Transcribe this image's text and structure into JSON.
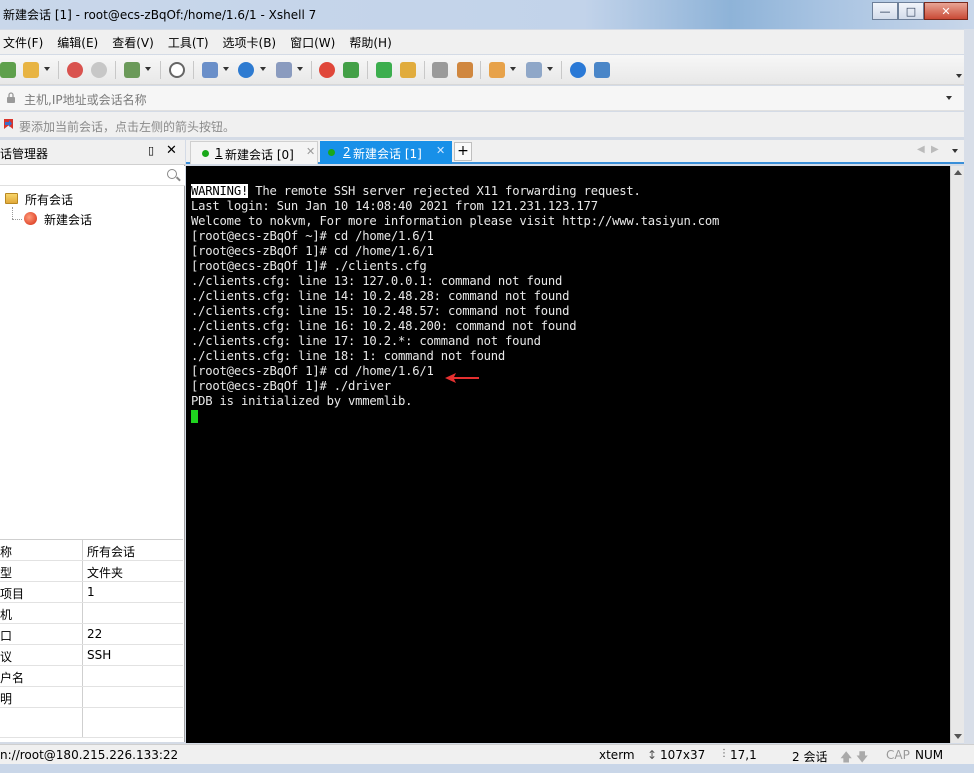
{
  "window": {
    "title": "新建会话 [1] - root@ecs-zBqOf:/home/1.6/1 - Xshell 7",
    "controls": [
      "minimize",
      "maximize",
      "close"
    ]
  },
  "menu": [
    "文件(F)",
    "编辑(E)",
    "查看(V)",
    "工具(T)",
    "选项卡(B)",
    "窗口(W)",
    "帮助(H)"
  ],
  "address": {
    "placeholder": "主机,IP地址或会话名称"
  },
  "hint": "要添加当前会话，点击左侧的箭头按钮。",
  "session_panel": {
    "title": "话管理器",
    "pin": "ㅁ",
    "close": "✕",
    "tree": {
      "root": "所有会话",
      "child": "新建会话"
    },
    "properties": [
      {
        "key": "称",
        "value": "所有会话"
      },
      {
        "key": "型",
        "value": "文件夹"
      },
      {
        "key": "项目",
        "value": "1"
      },
      {
        "key": "机",
        "value": ""
      },
      {
        "key": "口",
        "value": "22"
      },
      {
        "key": "议",
        "value": "SSH"
      },
      {
        "key": "户名",
        "value": ""
      },
      {
        "key": "明",
        "value": ""
      }
    ]
  },
  "tabs": [
    {
      "number": "1",
      "label": "新建会话 [0]",
      "active": false
    },
    {
      "number": "2",
      "label": "新建会话 [1]",
      "active": true
    }
  ],
  "tab_add": "+",
  "terminal": {
    "warning_tag": "WARNING!",
    "warning_rest": " The remote SSH server rejected X11 forwarding request.",
    "lines": [
      "Last login: Sun Jan 10 14:08:40 2021 from 121.231.123.177",
      "Welcome to nokvm, For more information please visit http://www.tasiyun.com",
      "[root@ecs-zBqOf ~]# cd /home/1.6/1",
      "[root@ecs-zBqOf 1]# cd /home/1.6/1",
      "[root@ecs-zBqOf 1]# ./clients.cfg",
      "./clients.cfg: line 13: 127.0.0.1: command not found",
      "./clients.cfg: line 14: 10.2.48.28: command not found",
      "./clients.cfg: line 15: 10.2.48.57: command not found",
      "./clients.cfg: line 16: 10.2.48.200: command not found",
      "./clients.cfg: line 17: 10.2.*: command not found",
      "./clients.cfg: line 18: 1: command not found",
      "[root@ecs-zBqOf 1]# cd /home/1.6/1",
      "[root@ecs-zBqOf 1]# ./driver",
      "PDB is initialized by vmmemlib."
    ],
    "colors": {
      "background": "#000000",
      "text": "#e8e8e8",
      "cursor": "#1fd51f",
      "annotation_arrow": "#e53030"
    }
  },
  "status": {
    "connection": "n://root@180.215.226.133:22",
    "term_type": "xterm",
    "size": "107x37",
    "cursor_pos": "17,1",
    "sessions": "2 会话",
    "cap": "CAP",
    "num": "NUM"
  }
}
